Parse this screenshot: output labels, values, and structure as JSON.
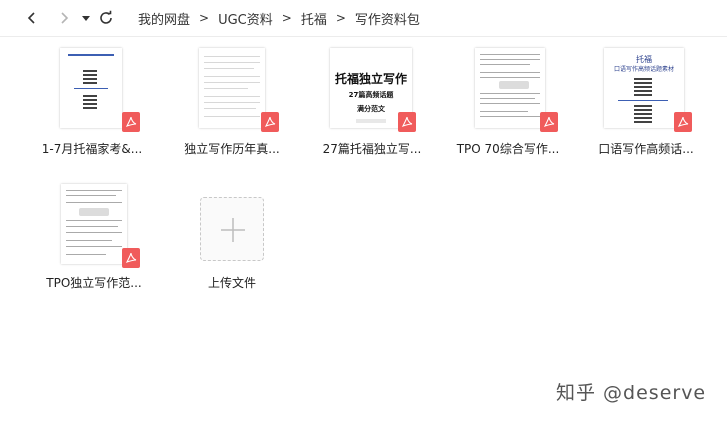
{
  "toolbar": {
    "back_icon": "chevron-left-icon",
    "forward_icon": "chevron-right-icon",
    "history_icon": "caret-down-icon",
    "refresh_icon": "refresh-icon",
    "breadcrumbs": [
      "我的网盘",
      "UGC资料",
      "托福",
      "写作资料包"
    ],
    "separator": ">"
  },
  "files": [
    {
      "name": "1-7月托福家考&...",
      "type": "pdf"
    },
    {
      "name": "独立写作历年真...",
      "type": "pdf"
    },
    {
      "name": "27篇托福独立写...",
      "type": "pdf",
      "thumb_title": "托福独立写作",
      "thumb_sub1": "27篇高频话题",
      "thumb_sub2": "满分范文"
    },
    {
      "name": "TPO 70综合写作...",
      "type": "pdf"
    },
    {
      "name": "口语写作高频话...",
      "type": "pdf",
      "thumb_title1": "托福",
      "thumb_title2": "口语写作高频话题素材"
    },
    {
      "name": "TPO独立写作范...",
      "type": "pdf"
    }
  ],
  "upload": {
    "label": "上传文件",
    "icon": "plus-icon"
  },
  "watermark": "知乎 @deserve",
  "colors": {
    "pdf_badge": "#f05b5b",
    "border": "#ececec",
    "accent_blue": "#3c5fb3"
  }
}
